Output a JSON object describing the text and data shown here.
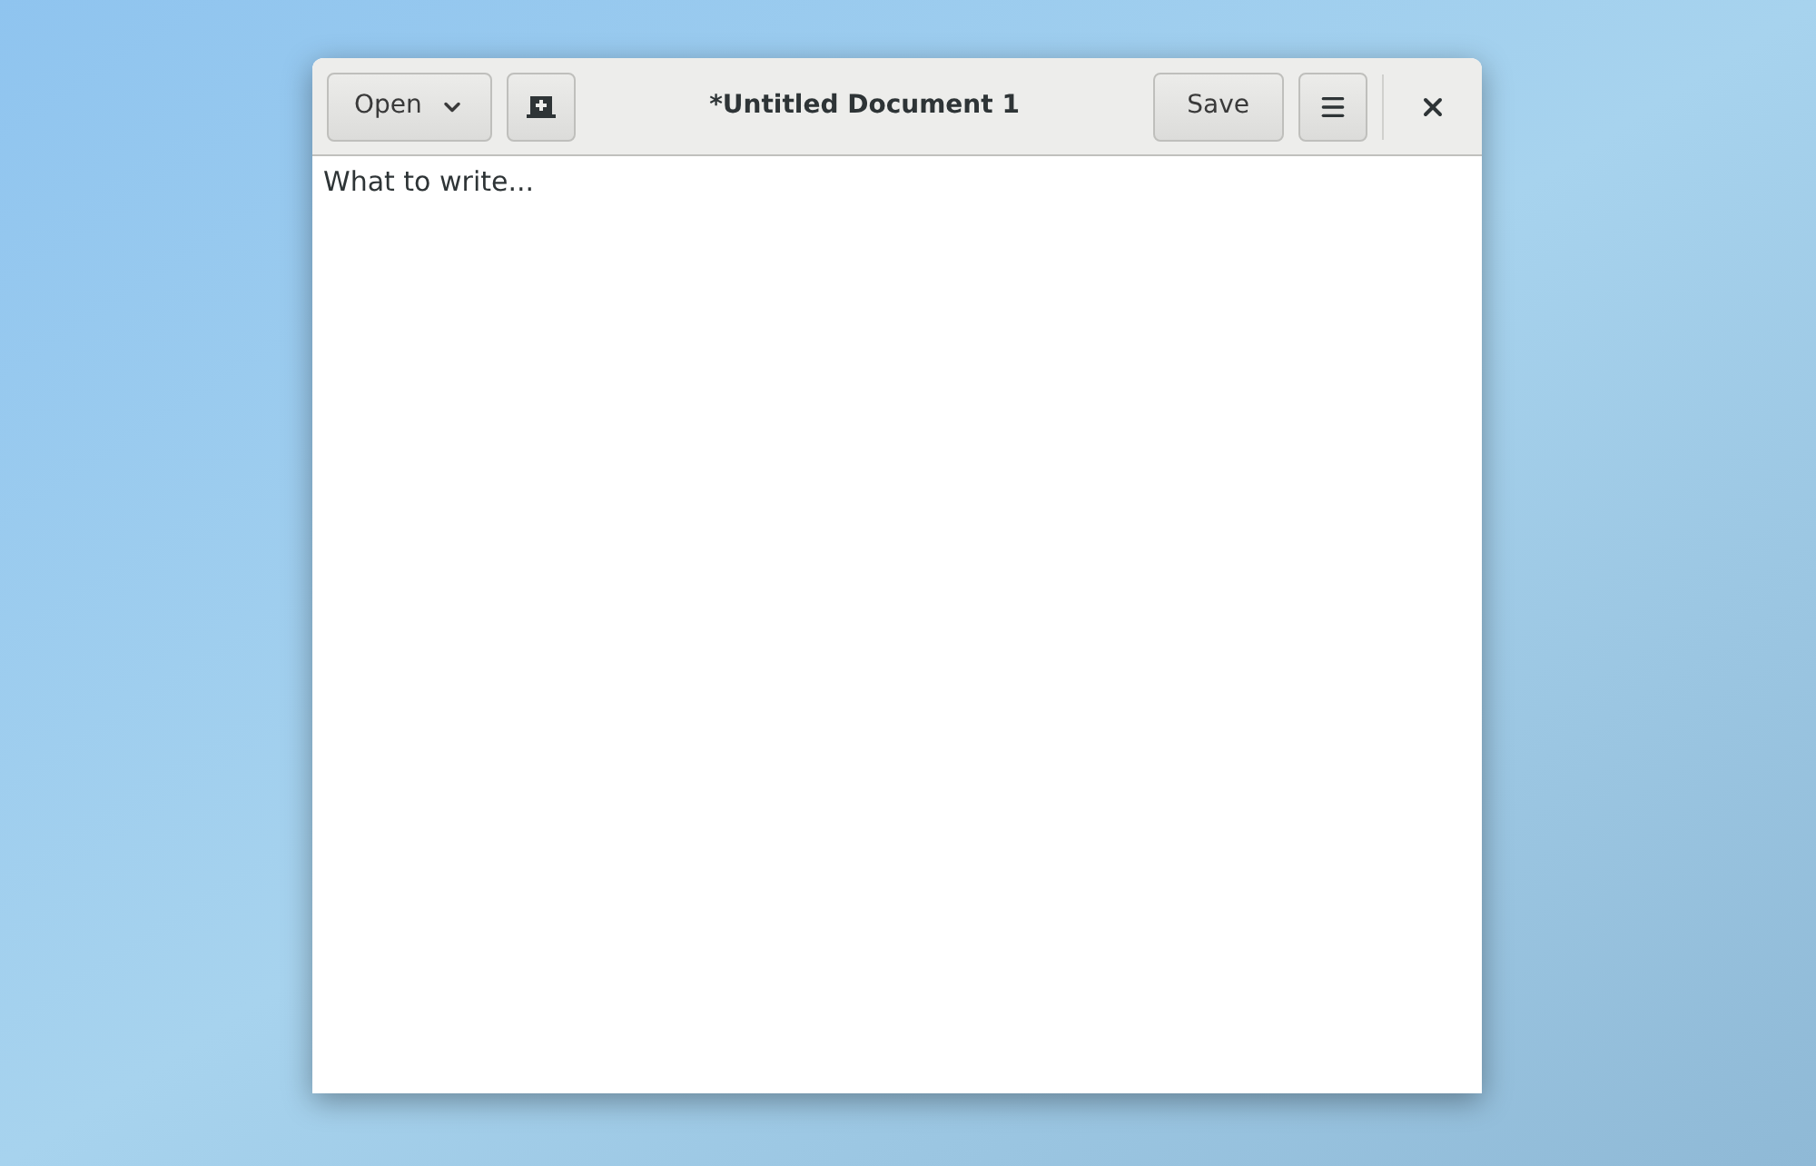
{
  "window": {
    "title": "*Untitled Document 1"
  },
  "header_bar": {
    "open_button": "Open",
    "save_button": "Save"
  },
  "editor": {
    "text": "What to write..."
  }
}
